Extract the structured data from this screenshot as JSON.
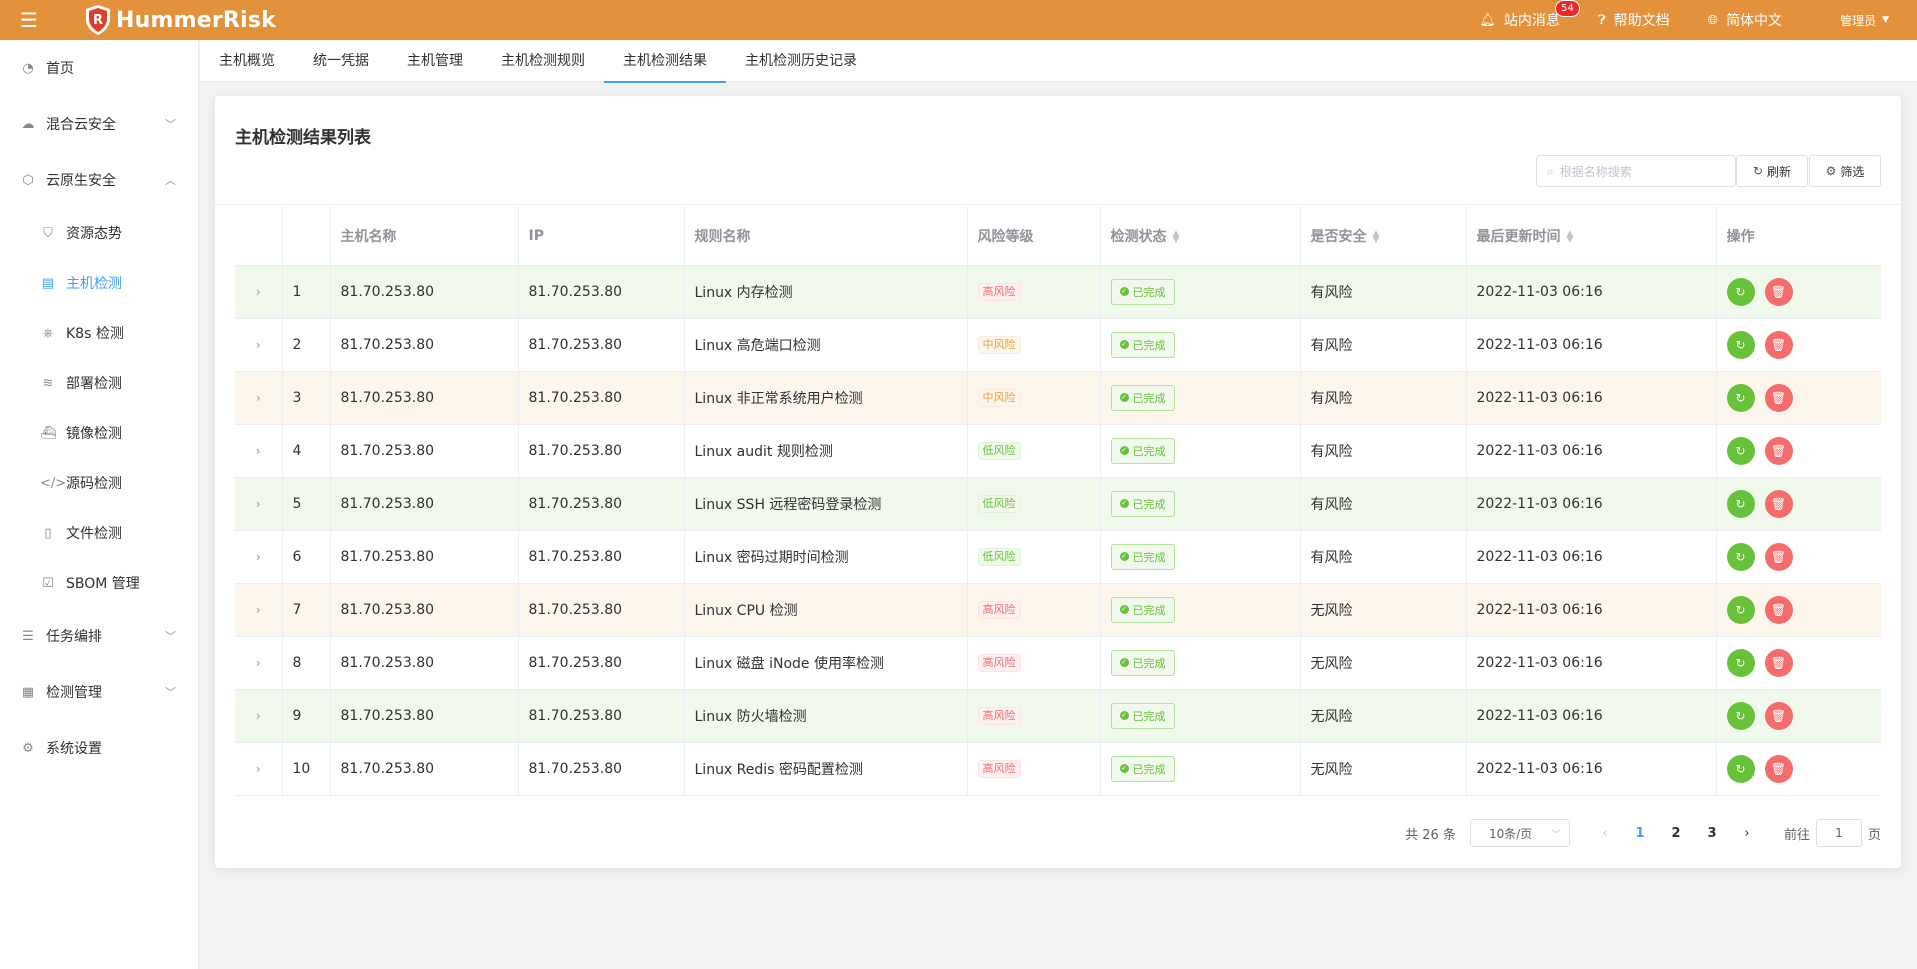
{
  "header": {
    "brand": "HummerRisk",
    "notifications_label": "站内消息",
    "notifications_count": "54",
    "help_label": "帮助文档",
    "language_label": "简体中文",
    "user_label": "管理员"
  },
  "sidebar": {
    "items": [
      {
        "label": "首页"
      },
      {
        "label": "混合云安全"
      },
      {
        "label": "云原生安全"
      },
      {
        "label": "资源态势"
      },
      {
        "label": "主机检测"
      },
      {
        "label": "K8s 检测"
      },
      {
        "label": "部署检测"
      },
      {
        "label": "镜像检测"
      },
      {
        "label": "源码检测"
      },
      {
        "label": "文件检测"
      },
      {
        "label": "SBOM 管理"
      },
      {
        "label": "任务编排"
      },
      {
        "label": "检测管理"
      },
      {
        "label": "系统设置"
      }
    ]
  },
  "tabs": [
    {
      "label": "主机概览"
    },
    {
      "label": "统一凭据"
    },
    {
      "label": "主机管理"
    },
    {
      "label": "主机检测规则"
    },
    {
      "label": "主机检测结果"
    },
    {
      "label": "主机检测历史记录"
    }
  ],
  "card": {
    "title": "主机检测结果列表",
    "search_placeholder": "根据名称搜索",
    "refresh_label": "刷新",
    "filter_label": "筛选"
  },
  "table": {
    "columns": [
      "主机名称",
      "IP",
      "规则名称",
      "风险等级",
      "检测状态",
      "是否安全",
      "最后更新时间",
      "操作"
    ],
    "rows": [
      {
        "no": "1",
        "host": "81.70.253.80",
        "ip": "81.70.253.80",
        "rule": "Linux 内存检测",
        "risk": "高风险",
        "status": "已完成",
        "safe": "有风险",
        "time": "2022-11-03 06:16"
      },
      {
        "no": "2",
        "host": "81.70.253.80",
        "ip": "81.70.253.80",
        "rule": "Linux 高危端口检测",
        "risk": "中风险",
        "status": "已完成",
        "safe": "有风险",
        "time": "2022-11-03 06:16"
      },
      {
        "no": "3",
        "host": "81.70.253.80",
        "ip": "81.70.253.80",
        "rule": "Linux 非正常系统用户检测",
        "risk": "中风险",
        "status": "已完成",
        "safe": "有风险",
        "time": "2022-11-03 06:16"
      },
      {
        "no": "4",
        "host": "81.70.253.80",
        "ip": "81.70.253.80",
        "rule": "Linux audit 规则检测",
        "risk": "低风险",
        "status": "已完成",
        "safe": "有风险",
        "time": "2022-11-03 06:16"
      },
      {
        "no": "5",
        "host": "81.70.253.80",
        "ip": "81.70.253.80",
        "rule": "Linux SSH 远程密码登录检测",
        "risk": "低风险",
        "status": "已完成",
        "safe": "有风险",
        "time": "2022-11-03 06:16"
      },
      {
        "no": "6",
        "host": "81.70.253.80",
        "ip": "81.70.253.80",
        "rule": "Linux 密码过期时间检测",
        "risk": "低风险",
        "status": "已完成",
        "safe": "有风险",
        "time": "2022-11-03 06:16"
      },
      {
        "no": "7",
        "host": "81.70.253.80",
        "ip": "81.70.253.80",
        "rule": "Linux CPU 检测",
        "risk": "高风险",
        "status": "已完成",
        "safe": "无风险",
        "time": "2022-11-03 06:16"
      },
      {
        "no": "8",
        "host": "81.70.253.80",
        "ip": "81.70.253.80",
        "rule": "Linux 磁盘 iNode 使用率检测",
        "risk": "高风险",
        "status": "已完成",
        "safe": "无风险",
        "time": "2022-11-03 06:16"
      },
      {
        "no": "9",
        "host": "81.70.253.80",
        "ip": "81.70.253.80",
        "rule": "Linux 防火墙检测",
        "risk": "高风险",
        "status": "已完成",
        "safe": "无风险",
        "time": "2022-11-03 06:16"
      },
      {
        "no": "10",
        "host": "81.70.253.80",
        "ip": "81.70.253.80",
        "rule": "Linux Redis 密码配置检测",
        "risk": "高风险",
        "status": "已完成",
        "safe": "无风险",
        "time": "2022-11-03 06:16"
      }
    ]
  },
  "pagination": {
    "total": "共 26 条",
    "page_size": "10条/页",
    "pages": [
      "1",
      "2",
      "3"
    ],
    "goto_prefix": "前往",
    "goto_value": "1",
    "goto_suffix": "页"
  },
  "colors": {
    "brand": "#e3913a",
    "accent": "#409eff",
    "danger": "#f56c6c",
    "success": "#67c23a",
    "warning": "#e6a23c"
  }
}
